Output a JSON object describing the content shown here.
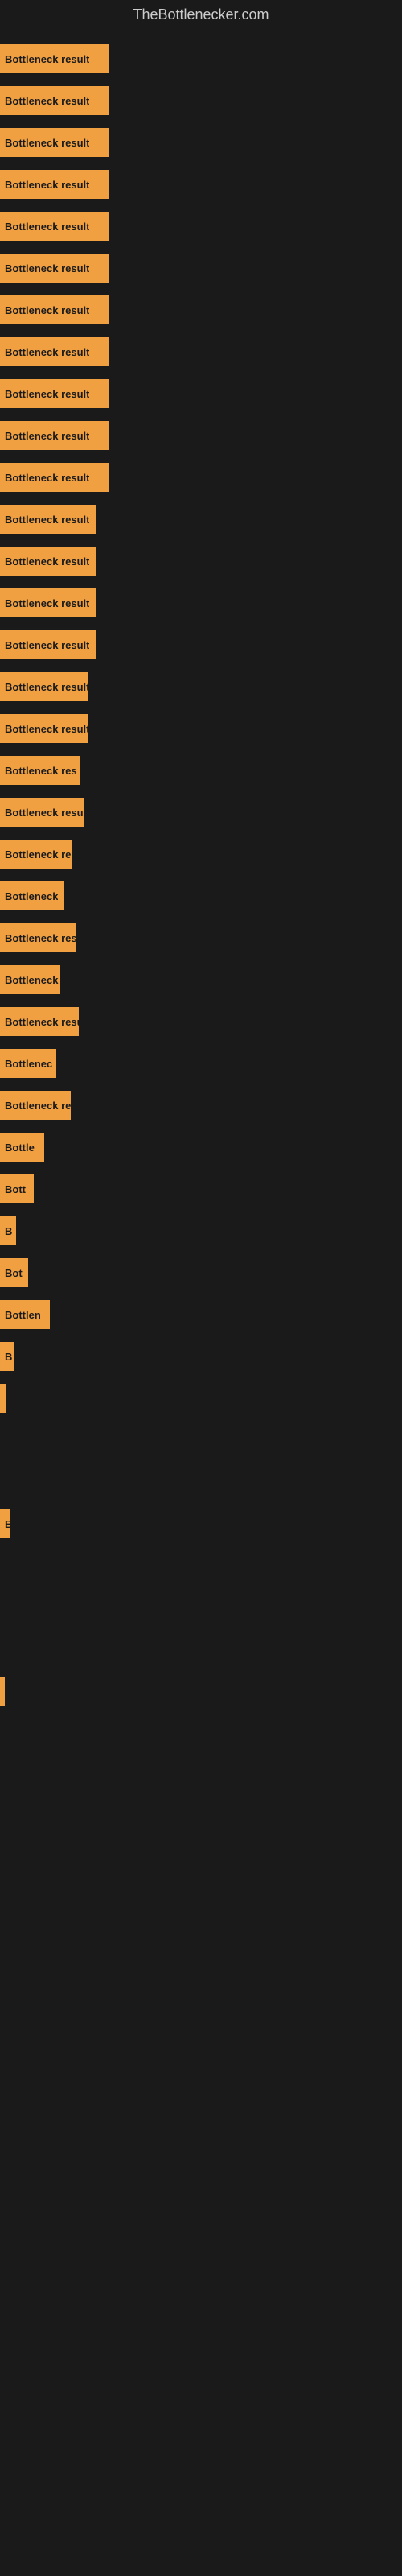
{
  "site": {
    "title": "TheBottlenecker.com"
  },
  "bars": [
    {
      "label": "Bottleneck result",
      "width": 135
    },
    {
      "label": "Bottleneck result",
      "width": 135
    },
    {
      "label": "Bottleneck result",
      "width": 135
    },
    {
      "label": "Bottleneck result",
      "width": 135
    },
    {
      "label": "Bottleneck result",
      "width": 135
    },
    {
      "label": "Bottleneck result",
      "width": 135
    },
    {
      "label": "Bottleneck result",
      "width": 135
    },
    {
      "label": "Bottleneck result",
      "width": 135
    },
    {
      "label": "Bottleneck result",
      "width": 135
    },
    {
      "label": "Bottleneck result",
      "width": 135
    },
    {
      "label": "Bottleneck result",
      "width": 135
    },
    {
      "label": "Bottleneck result",
      "width": 120
    },
    {
      "label": "Bottleneck result",
      "width": 120
    },
    {
      "label": "Bottleneck result",
      "width": 120
    },
    {
      "label": "Bottleneck result",
      "width": 120
    },
    {
      "label": "Bottleneck result",
      "width": 110
    },
    {
      "label": "Bottleneck result",
      "width": 110
    },
    {
      "label": "Bottleneck res",
      "width": 100
    },
    {
      "label": "Bottleneck result",
      "width": 105
    },
    {
      "label": "Bottleneck re",
      "width": 90
    },
    {
      "label": "Bottleneck",
      "width": 80
    },
    {
      "label": "Bottleneck res",
      "width": 95
    },
    {
      "label": "Bottleneck r",
      "width": 75
    },
    {
      "label": "Bottleneck resu",
      "width": 98
    },
    {
      "label": "Bottlenec",
      "width": 70
    },
    {
      "label": "Bottleneck re",
      "width": 88
    },
    {
      "label": "Bottle",
      "width": 55
    },
    {
      "label": "Bott",
      "width": 42
    },
    {
      "label": "B",
      "width": 20
    },
    {
      "label": "Bot",
      "width": 35
    },
    {
      "label": "Bottlen",
      "width": 62
    },
    {
      "label": "B",
      "width": 18
    },
    {
      "label": "",
      "width": 8
    },
    {
      "label": "",
      "width": 0
    },
    {
      "label": "",
      "width": 0
    },
    {
      "label": "B",
      "width": 12
    },
    {
      "label": "",
      "width": 0
    },
    {
      "label": "",
      "width": 0
    },
    {
      "label": "",
      "width": 0
    },
    {
      "label": "",
      "width": 4
    }
  ]
}
